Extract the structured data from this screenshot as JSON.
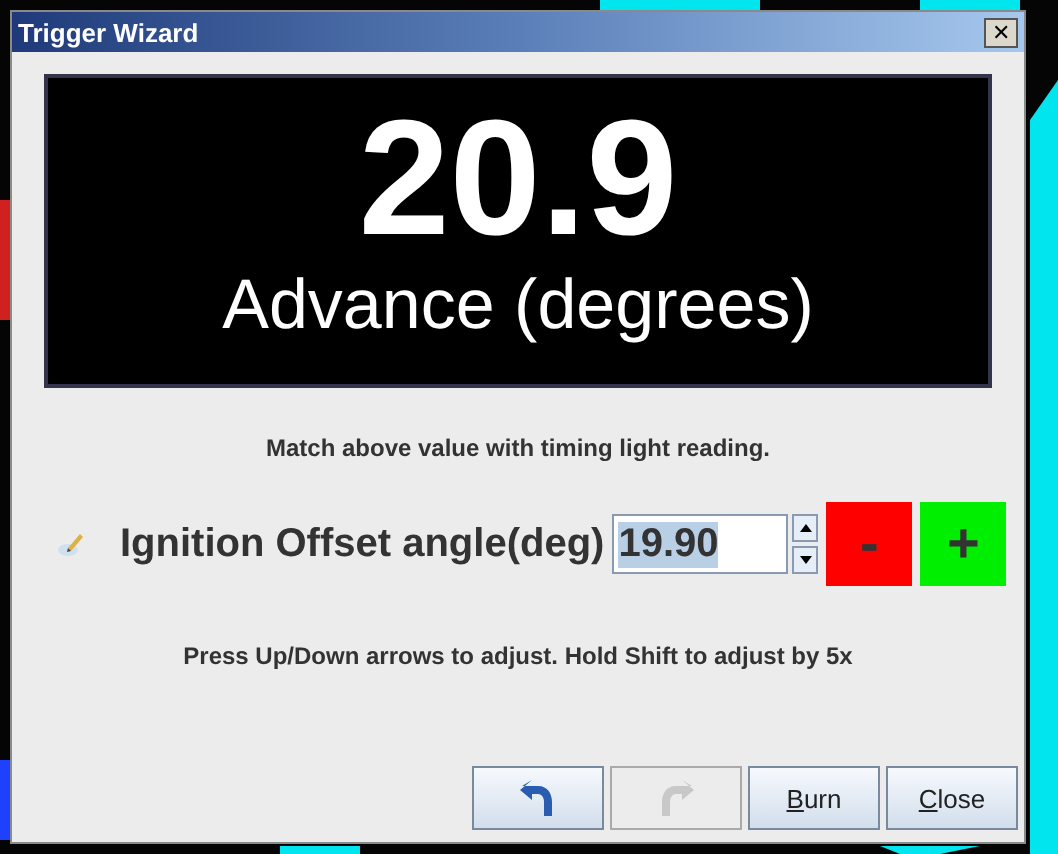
{
  "window": {
    "title": "Trigger Wizard",
    "close": "✕"
  },
  "display": {
    "value": "20.9",
    "label": "Advance (degrees)"
  },
  "instruction": "Match above value with timing light reading.",
  "offset": {
    "label": "Ignition Offset angle(deg)",
    "value": "19.90",
    "decrement": "-",
    "increment": "+"
  },
  "hint": "Press Up/Down arrows to adjust. Hold Shift to adjust by 5x",
  "buttons": [
    {
      "kind": "undo",
      "disabled": false
    },
    {
      "kind": "redo",
      "disabled": true
    },
    {
      "kind": "text",
      "label": "Burn",
      "disabled": false
    },
    {
      "kind": "text",
      "label": "Close",
      "disabled": false
    }
  ]
}
